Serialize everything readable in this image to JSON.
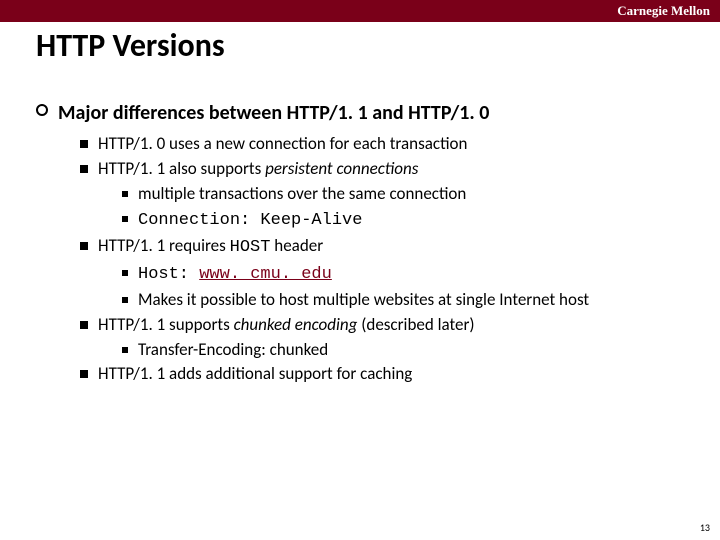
{
  "header": {
    "brand": "Carnegie Mellon"
  },
  "title": "HTTP Versions",
  "outline": {
    "heading": "Major differences between HTTP/1. 1 and HTTP/1. 0",
    "b1": "HTTP/1. 0 uses a new connection for each transaction",
    "b2_pre": "HTTP/1. 1 also supports ",
    "b2_ital": "persistent connections",
    "b2a": "multiple transactions over the same connection",
    "b2b": "Connection: Keep-Alive",
    "b3_pre": "HTTP/1. 1 requires ",
    "b3_code": "HOST",
    "b3_post": " header",
    "b3a_pre": "Host: ",
    "b3a_link": "www. cmu. edu",
    "b3b": "Makes it possible to host multiple websites at single Internet host",
    "b4_pre": "HTTP/1. 1 supports ",
    "b4_ital": "chunked encoding",
    "b4_post": " (described later)",
    "b4a": "Transfer-Encoding: chunked",
    "b5": "HTTP/1. 1 adds additional support for caching"
  },
  "page_number": "13"
}
